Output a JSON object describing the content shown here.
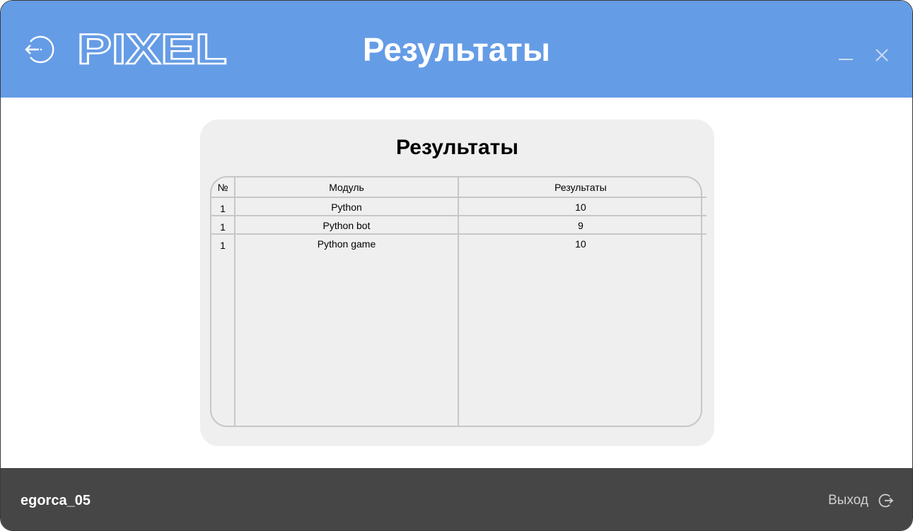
{
  "header": {
    "logo_text": "PIXEL",
    "title": "Результаты",
    "back_icon": "back-arrow-circle-icon",
    "minimize_icon": "minimize-icon",
    "close_icon": "close-icon"
  },
  "card": {
    "title": "Результаты",
    "table": {
      "columns": [
        "№",
        "Модуль",
        "Результаты"
      ],
      "rows": [
        {
          "num": "1",
          "module": "Python",
          "result": "10"
        },
        {
          "num": "1",
          "module": "Python bot",
          "result": "9"
        },
        {
          "num": "1",
          "module": "Python game",
          "result": "10"
        }
      ]
    }
  },
  "footer": {
    "username": "egorca_05",
    "logout_label": "Выход",
    "logout_icon": "logout-icon"
  },
  "colors": {
    "header_bg": "#659ce6",
    "footer_bg": "#464646",
    "card_bg": "#efefef",
    "table_border": "#c7c7c7"
  }
}
